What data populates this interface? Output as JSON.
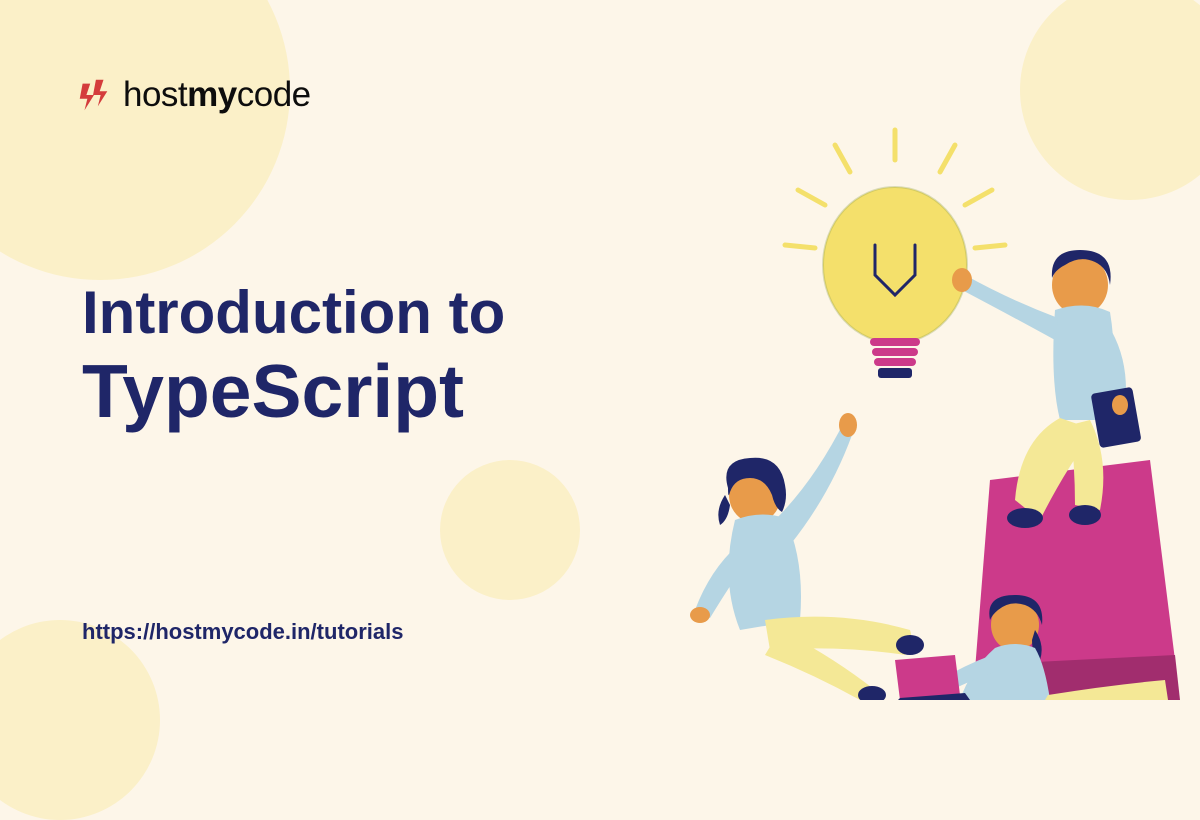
{
  "logo": {
    "brand_prefix": "host",
    "brand_bold": "my",
    "brand_suffix": "code"
  },
  "heading": {
    "line1": "Introduction to",
    "line2": "TypeScript"
  },
  "url": "https://hostmycode.in/tutorials",
  "colors": {
    "background": "#fdf6e9",
    "accent_circle": "#fbf0c8",
    "text_primary": "#1f2668",
    "logo_accent": "#d43c3c",
    "bulb_yellow": "#f4e06b",
    "skin": "#e89b4a",
    "hair": "#1f2668",
    "shirt": "#b5d5e3",
    "pants": "#f4e896",
    "magenta": "#cc3a8a"
  }
}
